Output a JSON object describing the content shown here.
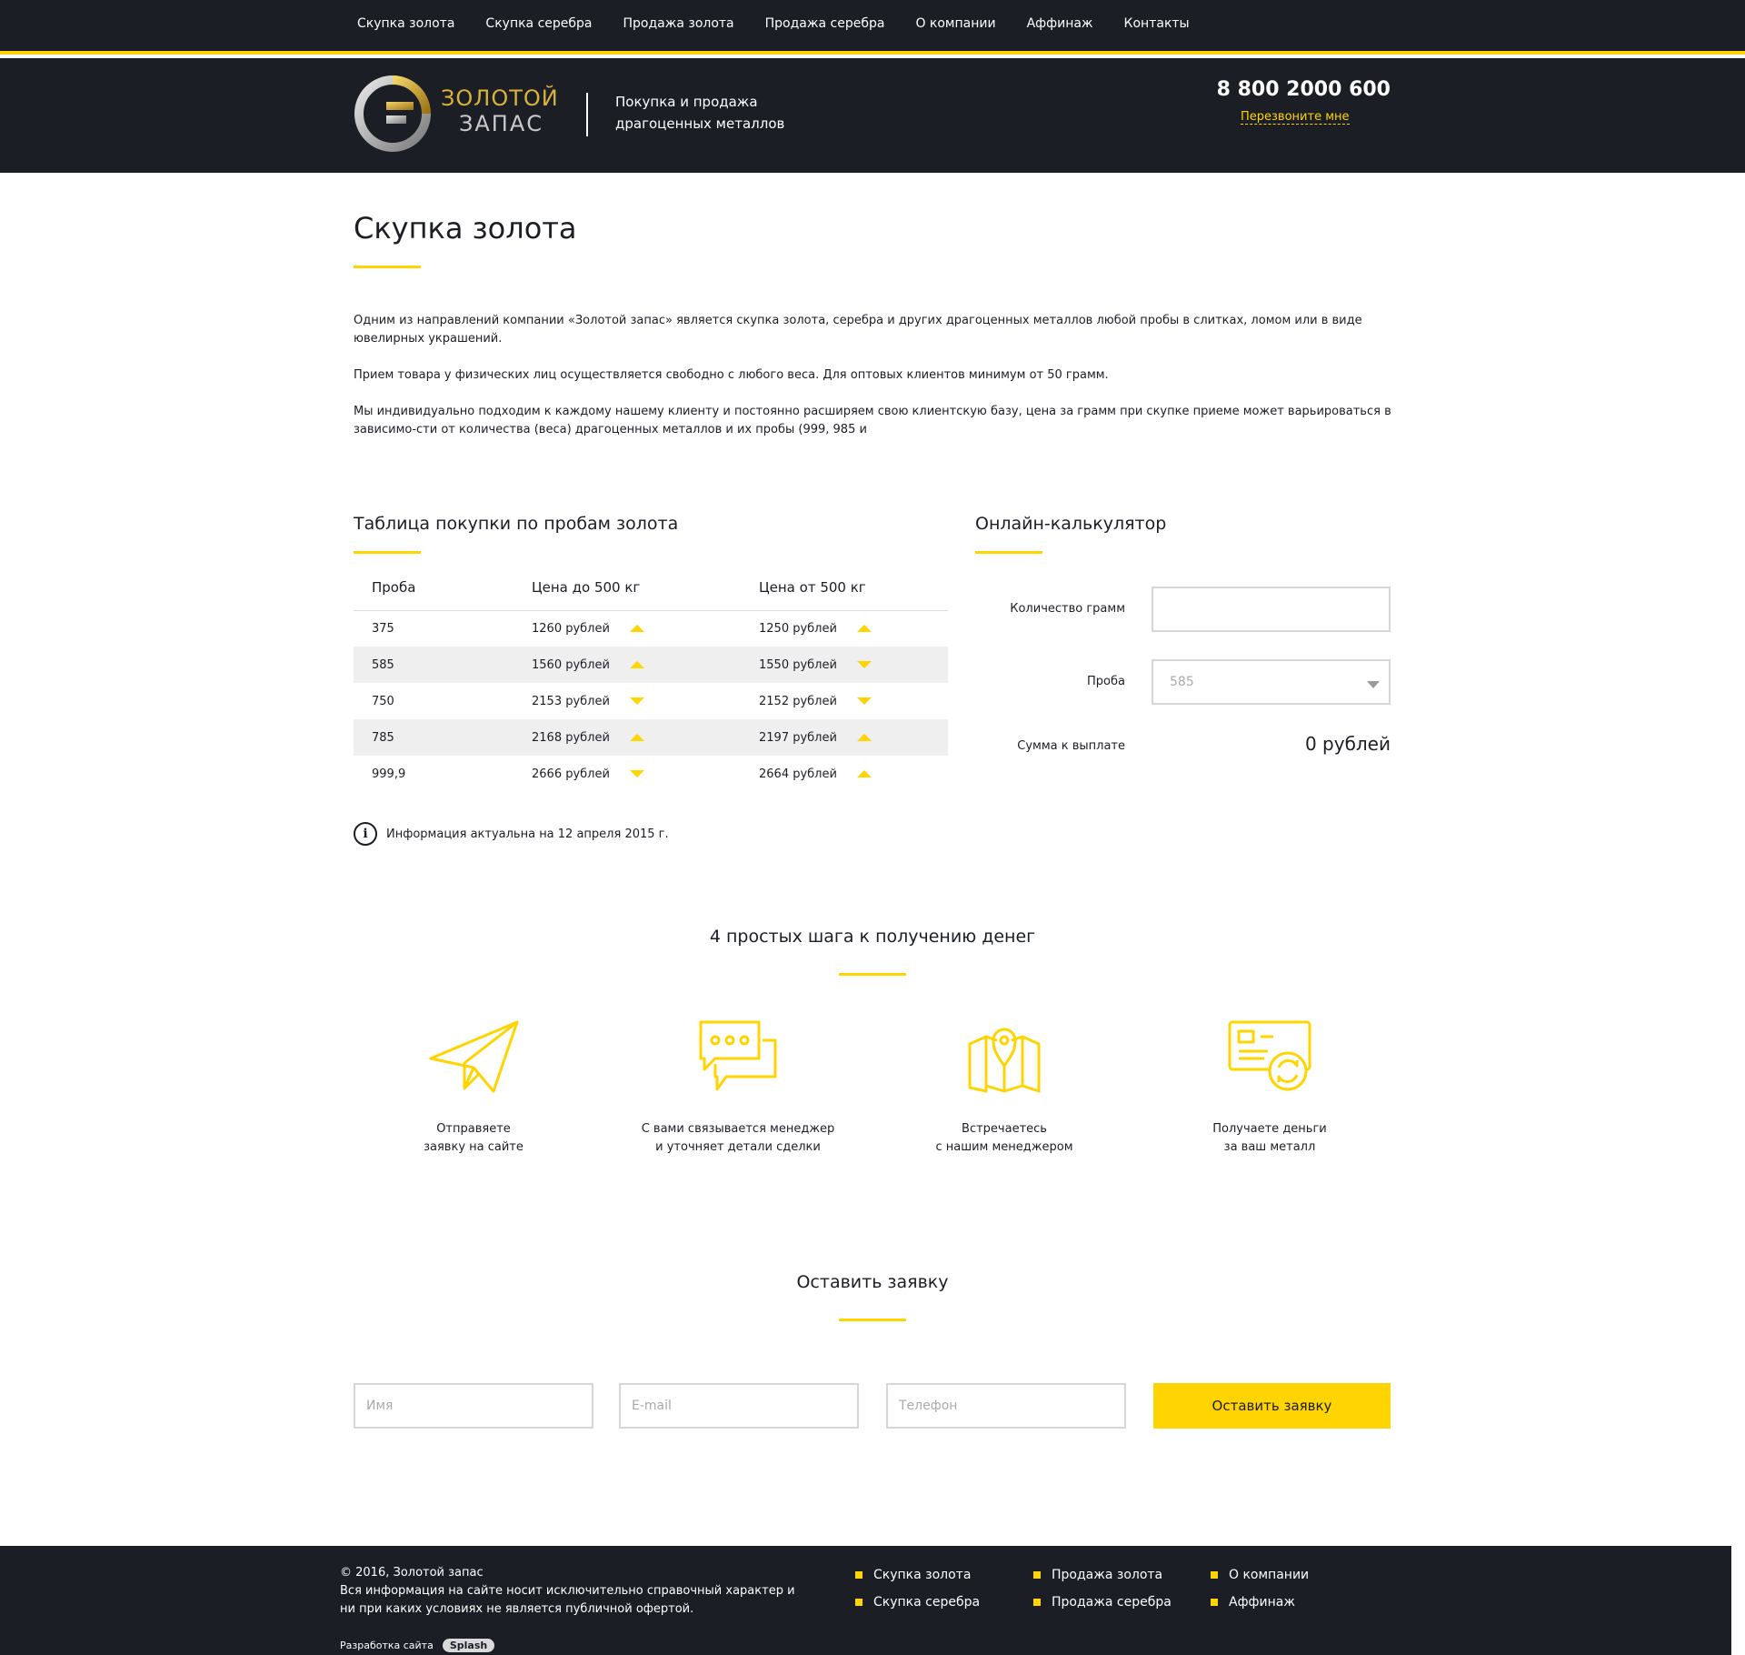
{
  "colors": {
    "accent": "#ffd400",
    "dark": "#1b1e25",
    "stripe": "#efefef"
  },
  "nav": [
    "Скупка золота",
    "Скупка серебра",
    "Продажа золота",
    "Продажа серебра",
    "О компании",
    "Аффинаж",
    "Контакты"
  ],
  "header": {
    "logo_line1": "ЗОЛОТОЙ",
    "logo_line2": "ЗАПАС",
    "tagline1": "Покупка и продажа",
    "tagline2": "драгоценных металлов",
    "phone": "8 800 2000 600",
    "callback": "Перезвоните мне"
  },
  "page_title": "Скупка золота",
  "intro": [
    "Одним из направлений компании «Золотой запас» является скупка золота, серебра и других драгоценных металлов любой пробы в слитках, ломом или в виде ювелирных украшений.",
    "Прием товара у физических лиц осуществляется свободно с любого веса. Для оптовых клиентов минимум от 50 грамм.",
    "Мы индивидуально подходим к каждому нашему клиенту и постоянно расширяем свою клиентскую базу, цена за грамм при скупке приеме может варьироваться в зависимо-сти от количества (веса) драгоценных металлов и их пробы (999, 985 и"
  ],
  "table": {
    "title": "Таблица покупки по пробам золота",
    "headers": [
      "Проба",
      "Цена до 500 кг",
      "Цена от 500 кг"
    ],
    "rows": [
      {
        "proba": "375",
        "price1": "1260 рублей",
        "trend1": "up-icon",
        "price2": "1250 рублей",
        "trend2": "up-icon"
      },
      {
        "proba": "585",
        "price1": "1560 рублей",
        "trend1": "up-icon",
        "price2": "1550 рублей",
        "trend2": "down-icon"
      },
      {
        "proba": "750",
        "price1": "2153 рублей",
        "trend1": "down-icon",
        "price2": "2152 рублей",
        "trend2": "down-icon"
      },
      {
        "proba": "785",
        "price1": "2168 рублей",
        "trend1": "up-icon",
        "price2": "2197 рублей",
        "trend2": "up-icon"
      },
      {
        "proba": "999,9",
        "price1": "2666 рублей",
        "trend1": "down-icon",
        "price2": "2664 рублей",
        "trend2": "up-icon"
      }
    ],
    "info_icon": "info-icon",
    "info": "Информация актуальна на 12 апреля 2015 г."
  },
  "calculator": {
    "title": "Онлайн-калькулятор",
    "grams_label": "Количество грамм",
    "grams_value": "",
    "proba_label": "Проба",
    "proba_selected": "585",
    "sum_label": "Сумма к выплате",
    "sum_value": "0 рублей"
  },
  "steps": {
    "title": "4 простых шага к получению денег",
    "items": [
      {
        "icon": "paper-plane-icon",
        "line1": "Отправяете",
        "line2": "заявку на сайте"
      },
      {
        "icon": "chat-bubbles-icon",
        "line1": "С вами связывается менеджер",
        "line2": "и уточняет детали сделки"
      },
      {
        "icon": "map-pin-icon",
        "line1": "Встречаетесь",
        "line2": "с нашим менеджером"
      },
      {
        "icon": "card-exchange-icon",
        "line1": "Получаете деньги",
        "line2": "за ваш металл"
      }
    ]
  },
  "form": {
    "title": "Оставить заявку",
    "name_placeholder": "Имя",
    "email_placeholder": "E-mail",
    "phone_placeholder": "Телефон",
    "submit": "Оставить заявку"
  },
  "footer": {
    "copyright": "© 2016, Золотой запас",
    "disclaimer": "Вся информация на сайте носит исключительно справочный характер и ни при каких условиях не является публичной офертой.",
    "dev_label": "Разработка сайта",
    "dev_logo": "Splash",
    "links": [
      "Скупка золота",
      "Скупка серебра",
      "Продажа золота",
      "Продажа серебра",
      "О компании",
      "Аффинаж"
    ]
  }
}
